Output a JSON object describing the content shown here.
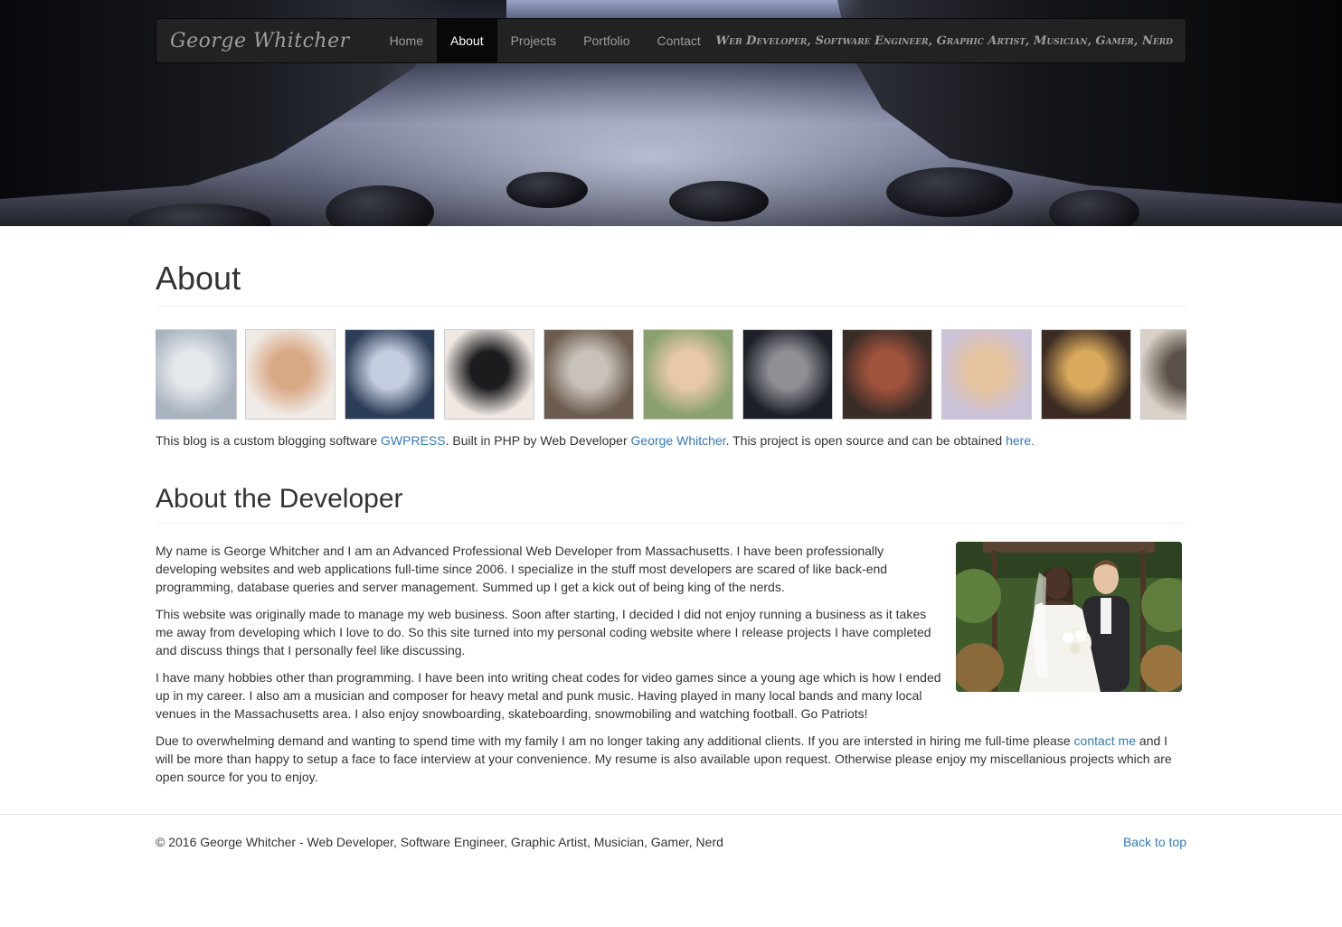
{
  "nav": {
    "brand": "George Whitcher",
    "items": [
      {
        "label": "Home",
        "active": false
      },
      {
        "label": "About",
        "active": true
      },
      {
        "label": "Projects",
        "active": false
      },
      {
        "label": "Portfolio",
        "active": false
      },
      {
        "label": "Contact",
        "active": false
      }
    ],
    "tagline": "Web Developer, Software Engineer, Graphic Artist, Musician, Gamer, Nerd"
  },
  "about": {
    "heading": "About",
    "thumbnails": [
      {
        "subject": "snowy-mountain-view",
        "colors": [
          "#a9b2bf",
          "#e4e7eb"
        ]
      },
      {
        "subject": "toddler-smiling",
        "colors": [
          "#f0ebe6",
          "#d9a885"
        ]
      },
      {
        "subject": "child-in-snow-gear",
        "colors": [
          "#2c3d57",
          "#c5cde0"
        ]
      },
      {
        "subject": "room-with-guitar-case",
        "colors": [
          "#efe8e3",
          "#1c1c1e"
        ]
      },
      {
        "subject": "toddler-standing-in-room",
        "colors": [
          "#6b5c4f",
          "#c9c2ba"
        ]
      },
      {
        "subject": "toddler-face-closeup",
        "colors": [
          "#8aa16f",
          "#e7c8a9"
        ]
      },
      {
        "subject": "man-with-snow-goggles",
        "colors": [
          "#1d2028",
          "#8f9096"
        ]
      },
      {
        "subject": "cluttered-desk",
        "colors": [
          "#3a2c26",
          "#a0533d"
        ]
      },
      {
        "subject": "toddler-on-couch",
        "colors": [
          "#cbc2d8",
          "#e5c39f"
        ]
      },
      {
        "subject": "toddler-with-book",
        "colors": [
          "#3b2b23",
          "#d9a95c"
        ]
      },
      {
        "subject": "guitars-on-wall",
        "colors": [
          "#d8d1c8",
          "#5a5049"
        ]
      }
    ],
    "intro": {
      "part1": "This blog is a custom blogging software ",
      "link1": "GWPRESS",
      "part2": ".  Built in PHP by Web Developer ",
      "link2": "George Whitcher",
      "part3": ".  This project is open source and can be obtained ",
      "link3": "here."
    }
  },
  "developer": {
    "heading": "About the Developer",
    "photo_subject": "wedding-photo",
    "p1": "My name is George Whitcher and I am an Advanced Professional Web Developer from Massachusetts. I have been professionally developing websites and web applications full-time since 2006.  I specialize in the stuff most developers are scared of like back-end programming, database queries and server management. Summed up I get a kick out of being king of the nerds.",
    "p2": "This website was originally made to manage my web business. Soon after starting, I decided I did not enjoy running a business as it takes me away from developing which I love to do. So this site turned into my personal coding website where I release projects I have completed and discuss things that I personally feel like discussing.",
    "p3": "I have many hobbies other than programming.  I have been into writing cheat codes for video games since a young age which is how I ended up in my career.  I also am a musician and composer for heavy metal and punk music. Having played in many local bands and many local venues in the Massachusetts area.  I also enjoy snowboarding, skateboarding, snowmobiling and watching football.  Go Patriots!",
    "p4_part1": "Due to overwhelming demand and wanting to spend time with my family I am no longer taking any additional clients.  If you are intersted in hiring me full-time please ",
    "p4_link": "contact me",
    "p4_part2": " and I will be more than happy to setup a face to face interview at your convenience.  My resume is also available upon request. Otherwise please enjoy my miscellanious projects which are open source for you to enjoy."
  },
  "footer": {
    "copyright": "© 2016 George Whitcher - Web Developer, Software Engineer, Graphic Artist, Musician, Gamer, Nerd",
    "back_to_top": "Back to top"
  }
}
